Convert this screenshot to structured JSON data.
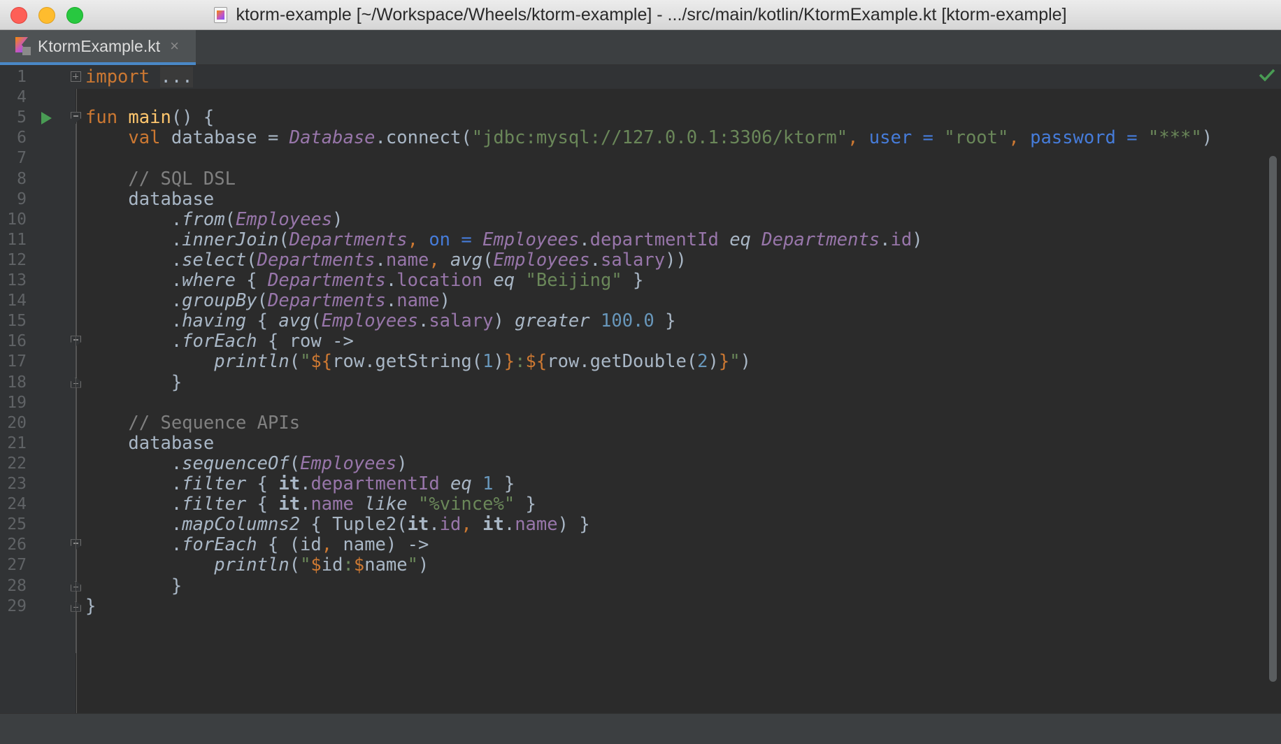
{
  "window": {
    "title": "ktorm-example [~/Workspace/Wheels/ktorm-example] - .../src/main/kotlin/KtormExample.kt [ktorm-example]"
  },
  "tab": {
    "label": "KtormExample.kt",
    "close": "×"
  },
  "editor": {
    "inspection_status": "ok",
    "lines": [
      {
        "n": "1",
        "tokens": [
          {
            "t": "import",
            "c": "kw"
          },
          {
            "t": " "
          },
          {
            "t": "...",
            "c": "fold-text"
          }
        ]
      },
      {
        "n": "4",
        "tokens": []
      },
      {
        "n": "5",
        "tokens": [
          {
            "t": "fun",
            "c": "kw"
          },
          {
            "t": " "
          },
          {
            "t": "main",
            "c": "fn"
          },
          {
            "t": "() {"
          }
        ]
      },
      {
        "n": "6",
        "tokens": [
          {
            "t": "    "
          },
          {
            "t": "val",
            "c": "kw"
          },
          {
            "t": " database = "
          },
          {
            "t": "Database",
            "c": "obj"
          },
          {
            "t": ".connect("
          },
          {
            "t": "\"jdbc:mysql://127.0.0.1:3306/ktorm\"",
            "c": "str"
          },
          {
            "t": ", ",
            "c": "kw"
          },
          {
            "t": "user = ",
            "c": "named"
          },
          {
            "t": "\"root\"",
            "c": "str"
          },
          {
            "t": ", ",
            "c": "kw"
          },
          {
            "t": "password = ",
            "c": "named"
          },
          {
            "t": "\"***\"",
            "c": "str"
          },
          {
            "t": ")"
          }
        ]
      },
      {
        "n": "7",
        "tokens": []
      },
      {
        "n": "8",
        "tokens": [
          {
            "t": "    "
          },
          {
            "t": "// SQL DSL",
            "c": "cmt"
          }
        ]
      },
      {
        "n": "9",
        "tokens": [
          {
            "t": "    database"
          }
        ]
      },
      {
        "n": "10",
        "tokens": [
          {
            "t": "        ."
          },
          {
            "t": "from",
            "c": "call"
          },
          {
            "t": "("
          },
          {
            "t": "Employees",
            "c": "obj"
          },
          {
            "t": ")"
          }
        ]
      },
      {
        "n": "11",
        "tokens": [
          {
            "t": "        ."
          },
          {
            "t": "innerJoin",
            "c": "call"
          },
          {
            "t": "("
          },
          {
            "t": "Departments",
            "c": "obj"
          },
          {
            "t": ", ",
            "c": "kw"
          },
          {
            "t": "on = ",
            "c": "named"
          },
          {
            "t": "Employees",
            "c": "obj"
          },
          {
            "t": "."
          },
          {
            "t": "departmentId",
            "c": "prop"
          },
          {
            "t": " "
          },
          {
            "t": "eq",
            "c": "call"
          },
          {
            "t": " "
          },
          {
            "t": "Departments",
            "c": "obj"
          },
          {
            "t": "."
          },
          {
            "t": "id",
            "c": "prop"
          },
          {
            "t": ")"
          }
        ]
      },
      {
        "n": "12",
        "tokens": [
          {
            "t": "        ."
          },
          {
            "t": "select",
            "c": "call"
          },
          {
            "t": "("
          },
          {
            "t": "Departments",
            "c": "obj"
          },
          {
            "t": "."
          },
          {
            "t": "name",
            "c": "prop"
          },
          {
            "t": ", ",
            "c": "kw"
          },
          {
            "t": "avg",
            "c": "call"
          },
          {
            "t": "("
          },
          {
            "t": "Employees",
            "c": "obj"
          },
          {
            "t": "."
          },
          {
            "t": "salary",
            "c": "prop"
          },
          {
            "t": "))"
          }
        ]
      },
      {
        "n": "13",
        "tokens": [
          {
            "t": "        ."
          },
          {
            "t": "where",
            "c": "call"
          },
          {
            "t": " { "
          },
          {
            "t": "Departments",
            "c": "obj"
          },
          {
            "t": "."
          },
          {
            "t": "location",
            "c": "prop"
          },
          {
            "t": " "
          },
          {
            "t": "eq",
            "c": "call"
          },
          {
            "t": " "
          },
          {
            "t": "\"Beijing\"",
            "c": "str"
          },
          {
            "t": " }"
          }
        ]
      },
      {
        "n": "14",
        "tokens": [
          {
            "t": "        ."
          },
          {
            "t": "groupBy",
            "c": "call"
          },
          {
            "t": "("
          },
          {
            "t": "Departments",
            "c": "obj"
          },
          {
            "t": "."
          },
          {
            "t": "name",
            "c": "prop"
          },
          {
            "t": ")"
          }
        ]
      },
      {
        "n": "15",
        "tokens": [
          {
            "t": "        ."
          },
          {
            "t": "having",
            "c": "call"
          },
          {
            "t": " { "
          },
          {
            "t": "avg",
            "c": "call"
          },
          {
            "t": "("
          },
          {
            "t": "Employees",
            "c": "obj"
          },
          {
            "t": "."
          },
          {
            "t": "salary",
            "c": "prop"
          },
          {
            "t": ") "
          },
          {
            "t": "greater",
            "c": "call"
          },
          {
            "t": " "
          },
          {
            "t": "100.0",
            "c": "num"
          },
          {
            "t": " }"
          }
        ]
      },
      {
        "n": "16",
        "tokens": [
          {
            "t": "        ."
          },
          {
            "t": "forEach",
            "c": "call"
          },
          {
            "t": " { row ->"
          }
        ]
      },
      {
        "n": "17",
        "tokens": [
          {
            "t": "            "
          },
          {
            "t": "println",
            "c": "call"
          },
          {
            "t": "("
          },
          {
            "t": "\"",
            "c": "str"
          },
          {
            "t": "${",
            "c": "tpl"
          },
          {
            "t": "row.getString("
          },
          {
            "t": "1",
            "c": "num"
          },
          {
            "t": ")"
          },
          {
            "t": "}",
            "c": "tpl"
          },
          {
            "t": ":",
            "c": "str"
          },
          {
            "t": "${",
            "c": "tpl"
          },
          {
            "t": "row.getDouble("
          },
          {
            "t": "2",
            "c": "num"
          },
          {
            "t": ")"
          },
          {
            "t": "}",
            "c": "tpl"
          },
          {
            "t": "\"",
            "c": "str"
          },
          {
            "t": ")"
          }
        ]
      },
      {
        "n": "18",
        "tokens": [
          {
            "t": "        }"
          }
        ]
      },
      {
        "n": "19",
        "tokens": []
      },
      {
        "n": "20",
        "tokens": [
          {
            "t": "    "
          },
          {
            "t": "// Sequence APIs",
            "c": "cmt"
          }
        ]
      },
      {
        "n": "21",
        "tokens": [
          {
            "t": "    database"
          }
        ]
      },
      {
        "n": "22",
        "tokens": [
          {
            "t": "        ."
          },
          {
            "t": "sequenceOf",
            "c": "call"
          },
          {
            "t": "("
          },
          {
            "t": "Employees",
            "c": "obj"
          },
          {
            "t": ")"
          }
        ]
      },
      {
        "n": "23",
        "tokens": [
          {
            "t": "        ."
          },
          {
            "t": "filter",
            "c": "call"
          },
          {
            "t": " { "
          },
          {
            "t": "it",
            "c": "bold"
          },
          {
            "t": "."
          },
          {
            "t": "departmentId",
            "c": "prop"
          },
          {
            "t": " "
          },
          {
            "t": "eq",
            "c": "call"
          },
          {
            "t": " "
          },
          {
            "t": "1",
            "c": "num"
          },
          {
            "t": " }"
          }
        ]
      },
      {
        "n": "24",
        "tokens": [
          {
            "t": "        ."
          },
          {
            "t": "filter",
            "c": "call"
          },
          {
            "t": " { "
          },
          {
            "t": "it",
            "c": "bold"
          },
          {
            "t": "."
          },
          {
            "t": "name",
            "c": "prop"
          },
          {
            "t": " "
          },
          {
            "t": "like",
            "c": "call"
          },
          {
            "t": " "
          },
          {
            "t": "\"%vince%\"",
            "c": "str"
          },
          {
            "t": " }"
          }
        ]
      },
      {
        "n": "25",
        "tokens": [
          {
            "t": "        ."
          },
          {
            "t": "mapColumns2",
            "c": "call"
          },
          {
            "t": " { Tuple2("
          },
          {
            "t": "it",
            "c": "bold"
          },
          {
            "t": "."
          },
          {
            "t": "id",
            "c": "prop"
          },
          {
            "t": ", ",
            "c": "kw"
          },
          {
            "t": "it",
            "c": "bold"
          },
          {
            "t": "."
          },
          {
            "t": "name",
            "c": "prop"
          },
          {
            "t": ") }"
          }
        ]
      },
      {
        "n": "26",
        "tokens": [
          {
            "t": "        ."
          },
          {
            "t": "forEach",
            "c": "call"
          },
          {
            "t": " { (id"
          },
          {
            "t": ", ",
            "c": "kw"
          },
          {
            "t": "name) ->"
          }
        ]
      },
      {
        "n": "27",
        "tokens": [
          {
            "t": "            "
          },
          {
            "t": "println",
            "c": "call"
          },
          {
            "t": "("
          },
          {
            "t": "\"",
            "c": "str"
          },
          {
            "t": "$",
            "c": "tpl"
          },
          {
            "t": "id"
          },
          {
            "t": ":",
            "c": "str"
          },
          {
            "t": "$",
            "c": "tpl"
          },
          {
            "t": "name"
          },
          {
            "t": "\"",
            "c": "str"
          },
          {
            "t": ")"
          }
        ]
      },
      {
        "n": "28",
        "tokens": [
          {
            "t": "        }"
          }
        ]
      },
      {
        "n": "29",
        "tokens": [
          {
            "t": "}"
          }
        ]
      }
    ]
  },
  "colors": {
    "background": "#2b2b2b",
    "gutter": "#313335",
    "keyword": "#cc7832",
    "function": "#ffc66d",
    "string": "#6a8759",
    "number": "#6897bb",
    "object": "#9876aa",
    "named_arg": "#467cda",
    "comment": "#808080",
    "tab_underline": "#4a88c7",
    "run_icon": "#499c54"
  }
}
